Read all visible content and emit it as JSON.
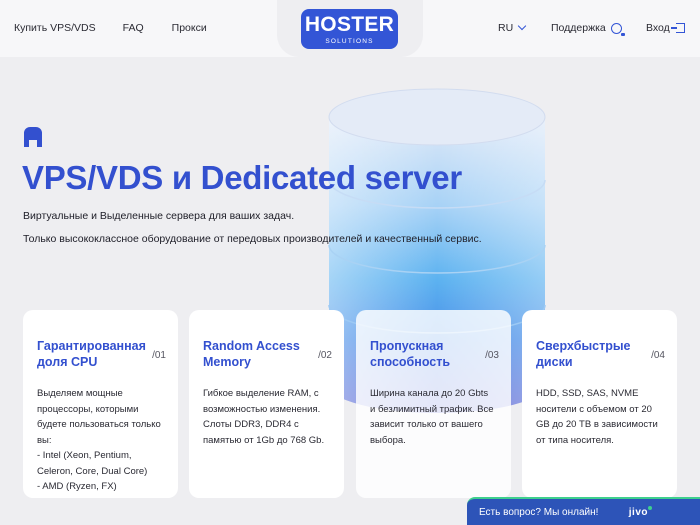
{
  "header": {
    "nav_left": [
      "Купить VPS/VDS",
      "FAQ",
      "Прокси"
    ],
    "logo_main": "HOSTER",
    "logo_sub": "SOLUTIONS",
    "language": "RU",
    "support": "Поддержка",
    "login": "Вход"
  },
  "hero": {
    "title": "VPS/VDS и Dedicated server",
    "subtitle_1": "Виртуальные и Выделенные сервера для ваших задач.",
    "subtitle_2": "Только высококлассное оборудование от передовых производителей и качественный сервис."
  },
  "cards": [
    {
      "title": "Гарантированная доля CPU",
      "num": "/01",
      "lines": [
        "Выделяем мощные",
        "процессоры, которыми",
        "будете пользоваться только",
        "вы:",
        "- Intel (Xeon, Pentium,",
        "Celeron, Core, Dual Core)",
        "- AMD (Ryzen, FX)"
      ]
    },
    {
      "title": "Random Access Memory",
      "num": "/02",
      "lines": [
        "Гибкое выделение RAM, с",
        "возможностью изменения.",
        "Слоты DDR3, DDR4 с",
        "памятью от 1Gb до 768 Gb."
      ]
    },
    {
      "title": "Пропускная способность",
      "num": "/03",
      "lines": [
        "Ширина канала до 20 Gbts",
        "и безлимитный трафик. Все",
        "зависит только от вашего",
        "выбора."
      ]
    },
    {
      "title": "Сверхбыстрые диски",
      "num": "/04",
      "lines": [
        "HDD, SSD, SAS, NVME",
        "носители с объемом от 20",
        "GB до 20 TB в зависимости",
        "от типа носителя."
      ]
    }
  ],
  "chat": {
    "prompt": "Есть вопрос? Мы онлайн!",
    "brand": "jivo"
  },
  "colors": {
    "accent": "#3350cf",
    "logo_bg": "#3355d6",
    "chat_bg": "#2d54b8",
    "chat_online": "#3ecf8e"
  },
  "icons": [
    "chevron-down-icon",
    "headset-icon",
    "login-icon",
    "brand-mark-icon"
  ]
}
